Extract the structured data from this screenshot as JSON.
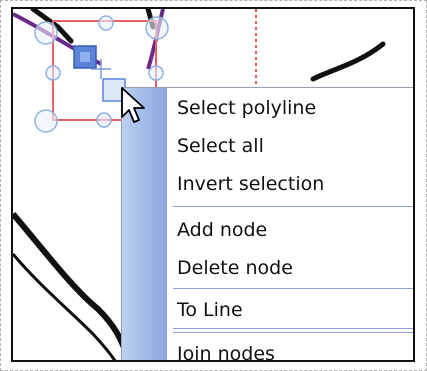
{
  "context_menu": {
    "items": [
      {
        "label": "Select polyline"
      },
      {
        "label": "Select all"
      },
      {
        "label": "Invert selection"
      },
      {
        "label": "Add node"
      },
      {
        "label": "Delete node"
      },
      {
        "label": "To Line"
      },
      {
        "label": "Join nodes"
      }
    ]
  },
  "colors": {
    "selection_box": "#e8606a",
    "handle_fill": "#d8e6fa",
    "handle_stroke": "#8fb0e0",
    "node_fill": "#5b84d8",
    "stroke_purple": "#6b2a8a",
    "guide_line": "#e85a5a",
    "menu_gutter": "#97b2e6"
  }
}
